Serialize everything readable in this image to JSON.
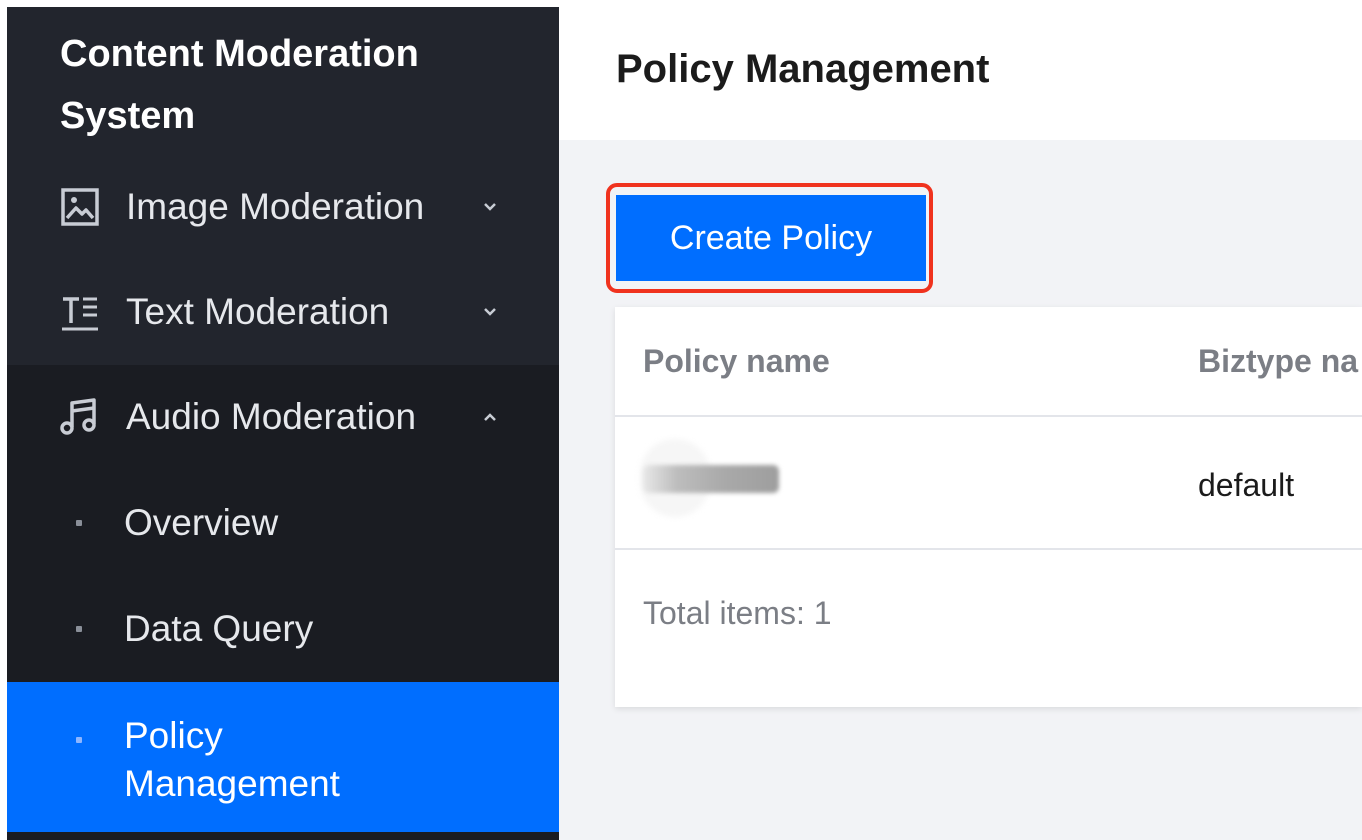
{
  "sidebar": {
    "brand": "Content Moderation System",
    "items": [
      {
        "label": "Image Moderation",
        "icon": "image-icon",
        "expanded": false
      },
      {
        "label": "Text Moderation",
        "icon": "text-icon",
        "expanded": false
      },
      {
        "label": "Audio Moderation",
        "icon": "music-icon",
        "expanded": true
      }
    ],
    "submenu": [
      {
        "label": "Overview",
        "active": false
      },
      {
        "label": "Data Query",
        "active": false
      },
      {
        "label": "Policy Management",
        "active": true
      }
    ]
  },
  "header": {
    "title": "Policy Management"
  },
  "toolbar": {
    "create_label": "Create Policy"
  },
  "table": {
    "columns": [
      "Policy name",
      "Biztype na"
    ],
    "rows": [
      {
        "policy_name": "",
        "biztype_name": "default"
      }
    ],
    "total": "Total items:  1"
  },
  "colors": {
    "sidebar_bg": "#22252d",
    "submenu_bg": "#1a1c22",
    "accent": "#006eff",
    "highlight": "#f0321e"
  }
}
